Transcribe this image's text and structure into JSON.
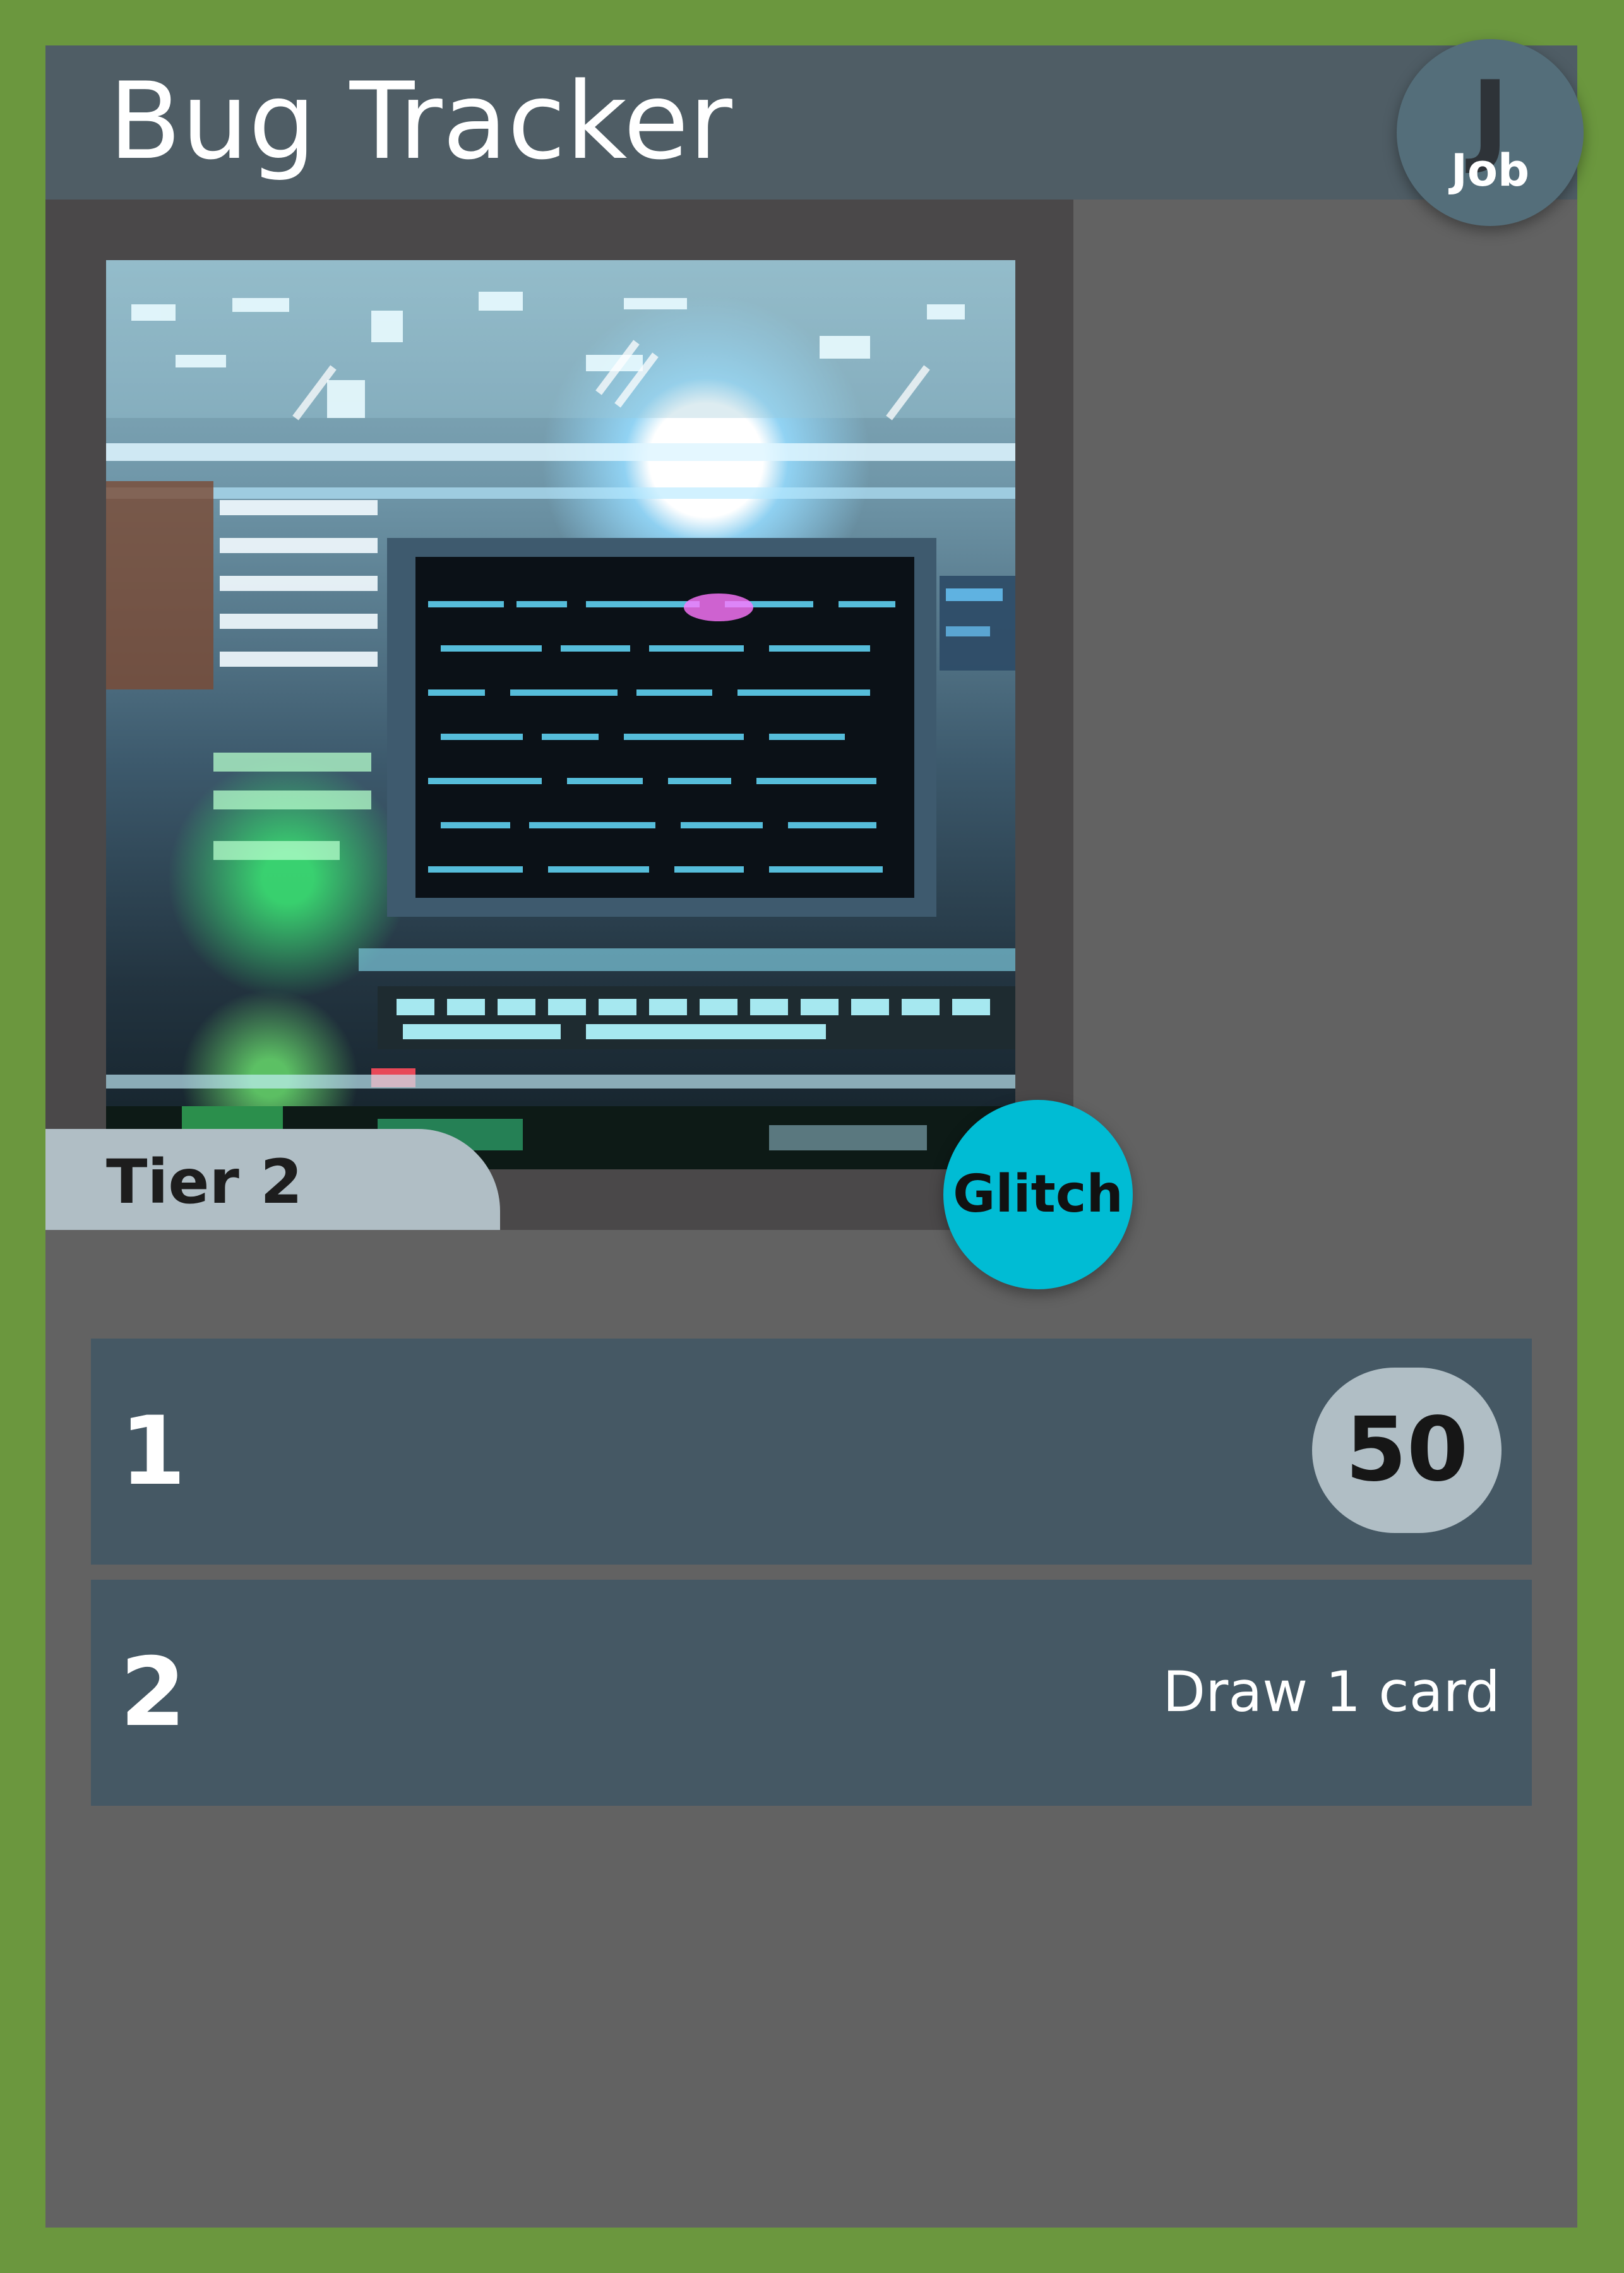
{
  "card": {
    "title": "Bug Tracker",
    "type_letter": "J",
    "type_label": "Job",
    "tier_label": "Tier 2",
    "keyword": "Glitch",
    "abilities": [
      {
        "number": "1",
        "value": "50"
      },
      {
        "number": "2",
        "effect": "Draw 1 card"
      }
    ]
  },
  "colors": {
    "border": "#6b973e",
    "card_background": "#626262",
    "title_bar": "#4f5d65",
    "type_badge": "#546e7a",
    "art_frame": "#4a4849",
    "tier_tab": "#b0bec5",
    "keyword_badge": "#00bcd4",
    "ability_row": "#455864",
    "value_pill": "#b0bec5"
  }
}
